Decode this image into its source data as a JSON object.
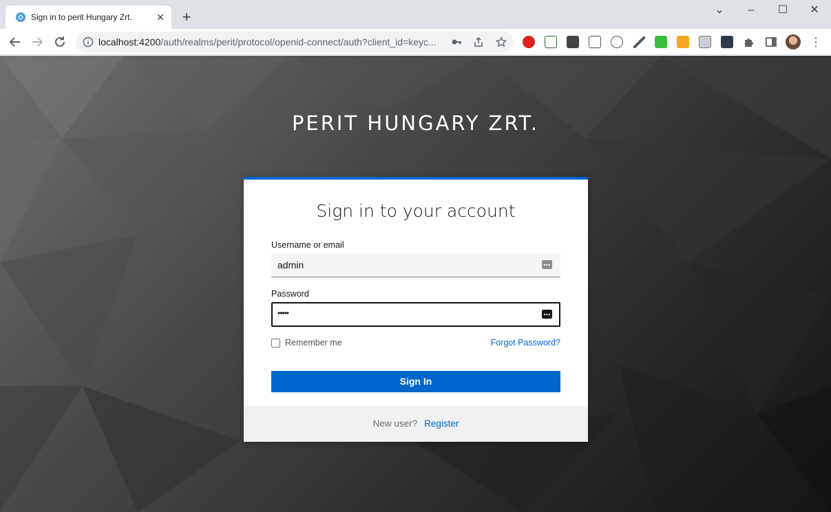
{
  "browser": {
    "tab_title": "Sign in to perit Hungary Zrt.",
    "url_host": "localhost:4200",
    "url_path": "/auth/realms/perit/protocol/openid-connect/auth?client_id=keyc..."
  },
  "page": {
    "realm_title": "PERIT HUNGARY ZRT.",
    "card_title": "Sign in to your account",
    "username_label": "Username or email",
    "username_value": "admin",
    "password_label": "Password",
    "password_value": "•••••",
    "remember_label": "Remember me",
    "forgot_label": "Forgot Password?",
    "signin_label": "Sign In",
    "newuser_text": "New user?",
    "register_label": "Register"
  },
  "colors": {
    "accent": "#0066cc",
    "tabstrip": "#dee1e6"
  }
}
